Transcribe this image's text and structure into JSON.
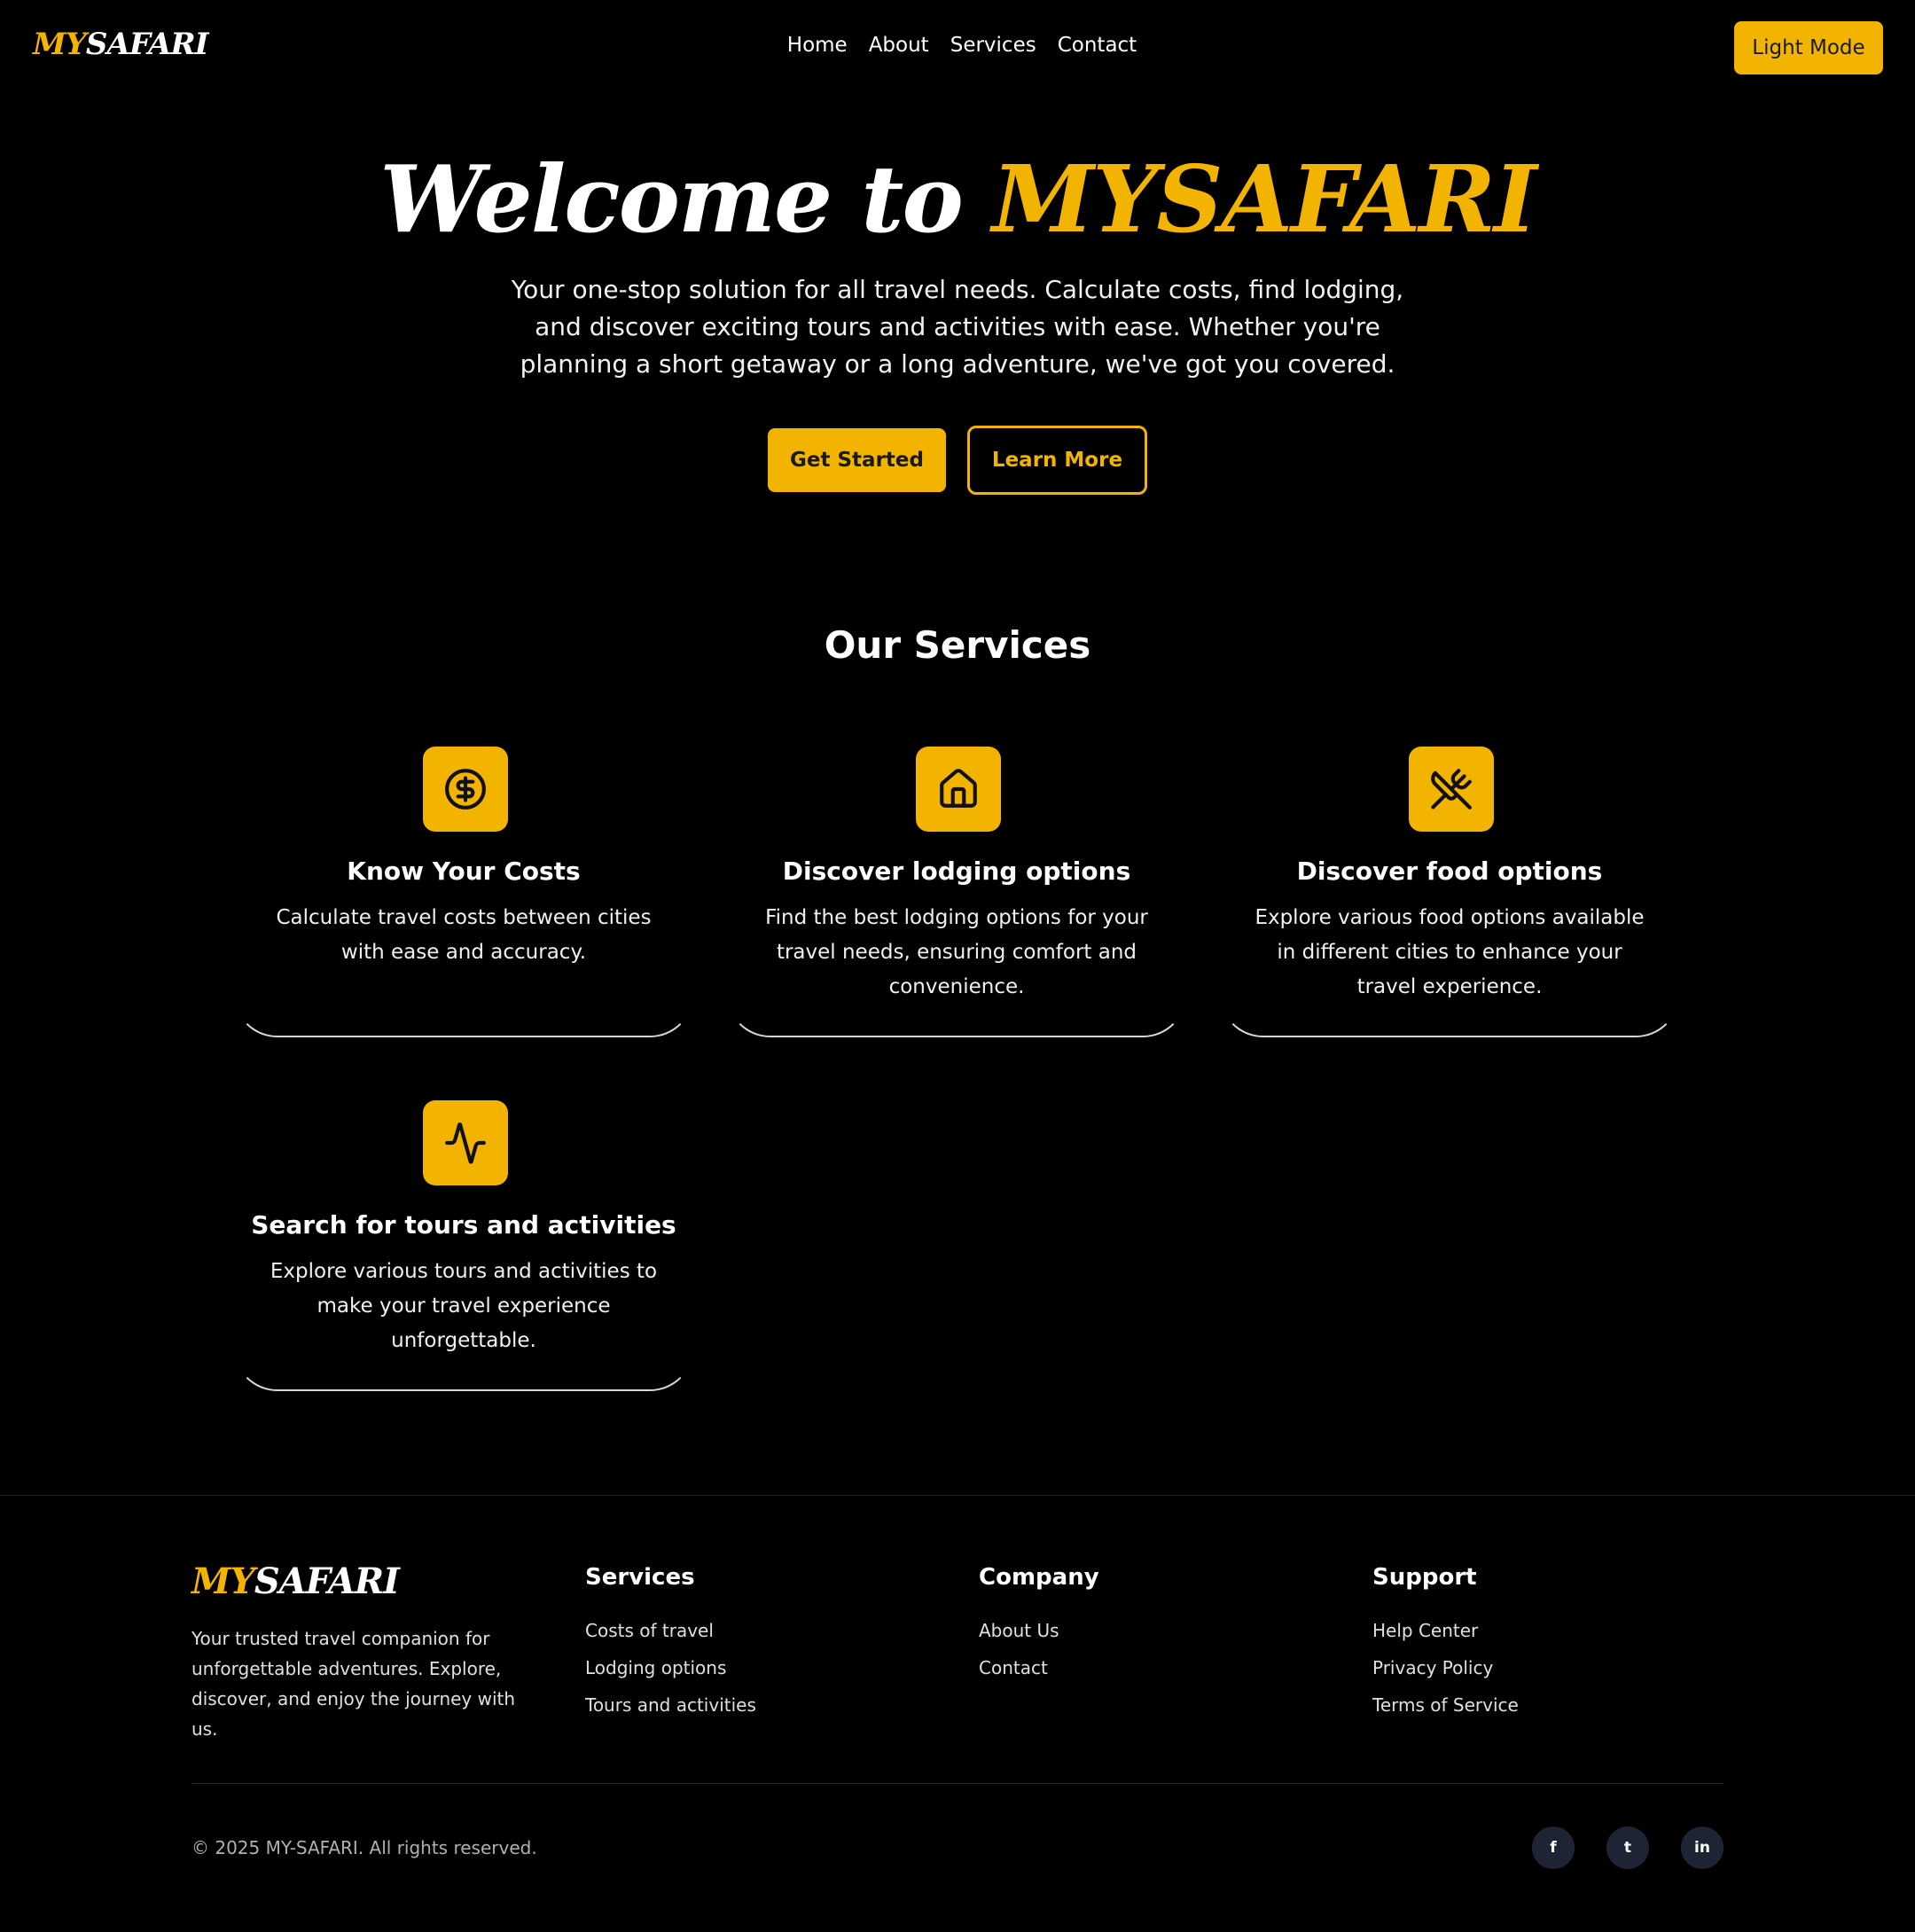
{
  "header": {
    "logo_prefix": "MY",
    "logo_suffix": "SAFARI",
    "nav": [
      "Home",
      "About",
      "Services",
      "Contact"
    ],
    "mode_toggle": "Light Mode"
  },
  "hero": {
    "title_prefix": "Welcome to ",
    "title_accent": "MYSAFARI",
    "subtitle": "Your one-stop solution for all travel needs. Calculate costs, find lodging, and discover exciting tours and activities with ease. Whether you're planning a short getaway or a long adventure, we've got you covered.",
    "primary_button": "Get Started",
    "secondary_button": "Learn More"
  },
  "services": {
    "title": "Our Services",
    "cards": [
      {
        "icon": "dollar-circle-icon",
        "title": "Know Your Costs",
        "description": "Calculate travel costs between cities with ease and accuracy."
      },
      {
        "icon": "house-icon",
        "title": "Discover lodging options",
        "description": "Find the best lodging options for your travel needs, ensuring comfort and convenience."
      },
      {
        "icon": "utensils-crossed-icon",
        "title": "Discover food options",
        "description": "Explore various food options available in different cities to enhance your travel experience."
      },
      {
        "icon": "activity-pulse-icon",
        "title": "Search for tours and activities",
        "description": "Explore various tours and activities to make your travel experience unforgettable."
      }
    ]
  },
  "footer": {
    "logo_prefix": "MY",
    "logo_suffix": "SAFARI",
    "description": "Your trusted travel companion for unforgettable adventures. Explore, discover, and enjoy the journey with us.",
    "columns": [
      {
        "title": "Services",
        "links": [
          "Costs of travel",
          "Lodging options",
          "Tours and activities"
        ]
      },
      {
        "title": "Company",
        "links": [
          "About Us",
          "Contact"
        ]
      },
      {
        "title": "Support",
        "links": [
          "Help Center",
          "Privacy Policy",
          "Terms of Service"
        ]
      }
    ],
    "copyright": "© 2025 MY-SAFARI. All rights reserved.",
    "social": [
      "f",
      "t",
      "in"
    ]
  },
  "colors": {
    "accent": "#f3b400",
    "background": "#000000",
    "social_bg": "#1e2433"
  }
}
